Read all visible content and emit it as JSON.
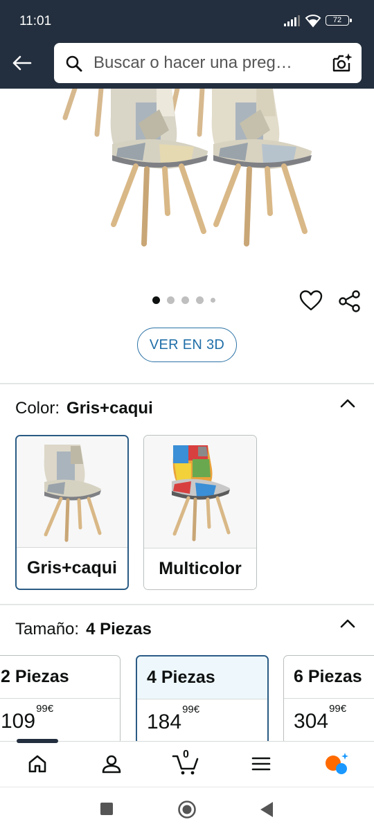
{
  "status_bar": {
    "time": "11:01",
    "battery": "72"
  },
  "header": {
    "search_placeholder": "Buscar o hacer una preg…"
  },
  "gallery": {
    "image_count": 5,
    "active_index": 0,
    "view_3d_label": "VER EN 3D"
  },
  "color_section": {
    "label": "Color:",
    "selected": "Gris+caqui",
    "options": [
      {
        "label": "Gris+caqui",
        "selected": true
      },
      {
        "label": "Multicolor",
        "selected": false
      }
    ]
  },
  "size_section": {
    "label": "Tamaño:",
    "selected": "4 Piezas",
    "options": [
      {
        "label": "2 Piezas",
        "price_whole": "109",
        "price_fraction": "99",
        "currency": "€",
        "selected": false
      },
      {
        "label": "4 Piezas",
        "price_whole": "184",
        "price_fraction": "99",
        "currency": "€",
        "selected": true
      },
      {
        "label": "6 Piezas",
        "price_whole": "304",
        "price_fraction": "99",
        "currency": "€",
        "selected": false
      }
    ]
  },
  "bottom_nav": {
    "cart_count": "0"
  },
  "colors": {
    "header_bg": "#232f3e",
    "link_blue": "#1f6ea8",
    "selected_border": "#2a5b84",
    "assistant_orange": "#ff6a00",
    "assistant_blue": "#1a98ff"
  }
}
